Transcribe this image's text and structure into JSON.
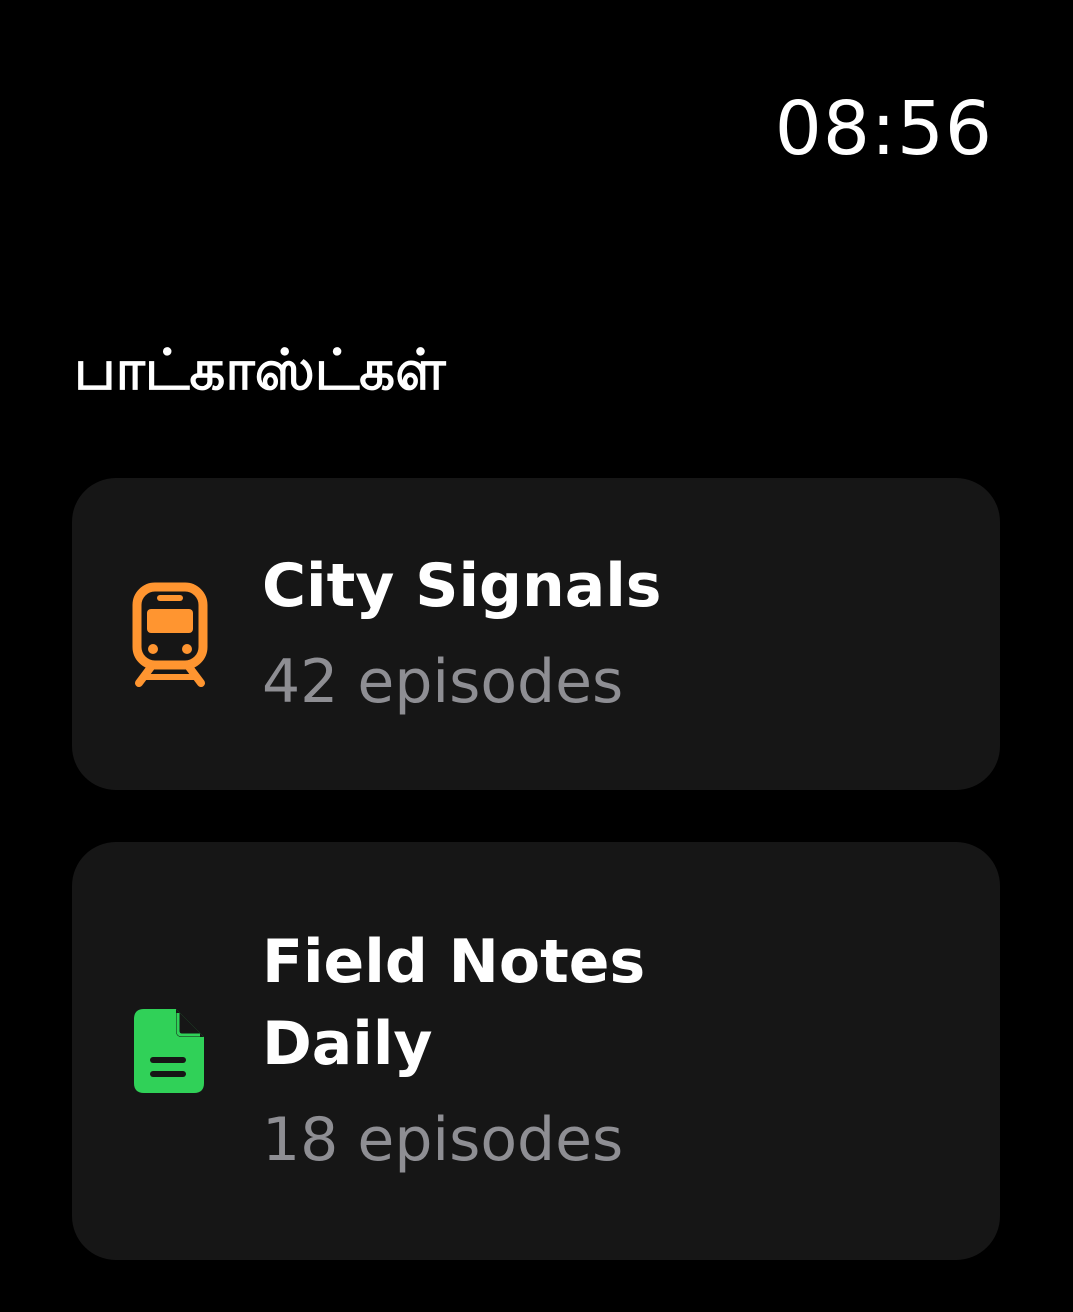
{
  "status_bar": {
    "time": "08:56"
  },
  "header": {
    "title": "பாட்காஸ்ட்கள்"
  },
  "podcasts": [
    {
      "title": "City Signals",
      "subtitle": "42 episodes",
      "icon": "train-icon",
      "icon_color": "#FF9530"
    },
    {
      "title": "Field Notes Daily",
      "title_lines": [
        "Field Notes",
        "Daily"
      ],
      "subtitle": "18 episodes",
      "icon": "document-icon",
      "icon_color": "#30D158"
    }
  ],
  "colors": {
    "background": "#000000",
    "card": "#161616",
    "text_primary": "#FFFFFF",
    "text_secondary": "#8E8E93"
  }
}
